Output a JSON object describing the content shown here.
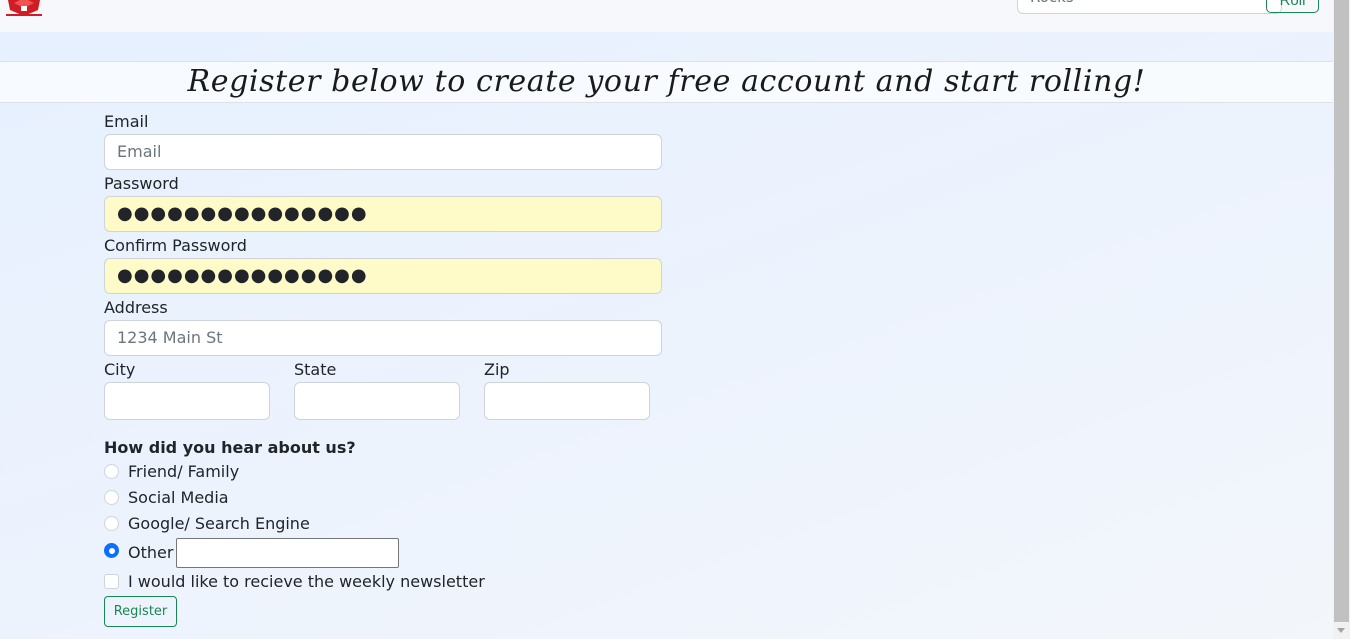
{
  "navbar": {
    "logo": "red-dice-logo",
    "search_value": "Rocks",
    "roll_label": "Roll"
  },
  "heading": {
    "title": "Register below to create your free account and start rolling!"
  },
  "form": {
    "email": {
      "label": "Email",
      "placeholder": "Email",
      "value": ""
    },
    "password": {
      "label": "Password",
      "value": "●●●●●●●●●●●●●●●"
    },
    "confirm_password": {
      "label": "Confirm Password",
      "value": "●●●●●●●●●●●●●●●"
    },
    "address": {
      "label": "Address",
      "placeholder": "1234 Main St",
      "value": ""
    },
    "city": {
      "label": "City",
      "value": ""
    },
    "state": {
      "label": "State",
      "value": ""
    },
    "zip": {
      "label": "Zip",
      "value": ""
    },
    "referral": {
      "question": "How did you hear about us?",
      "options": [
        {
          "label": "Friend/ Family",
          "checked": false
        },
        {
          "label": "Social Media",
          "checked": false
        },
        {
          "label": "Google/ Search Engine",
          "checked": false
        },
        {
          "label": "Other",
          "checked": true
        }
      ],
      "other_value": ""
    },
    "newsletter": {
      "label": "I would like to recieve the weekly newsletter",
      "checked": false
    },
    "submit_label": "Register"
  },
  "colors": {
    "accent_green": "#198754",
    "radio_blue": "#0d6efd",
    "autofill_yellow": "#fefbc8",
    "logo_red": "#d01c24"
  }
}
